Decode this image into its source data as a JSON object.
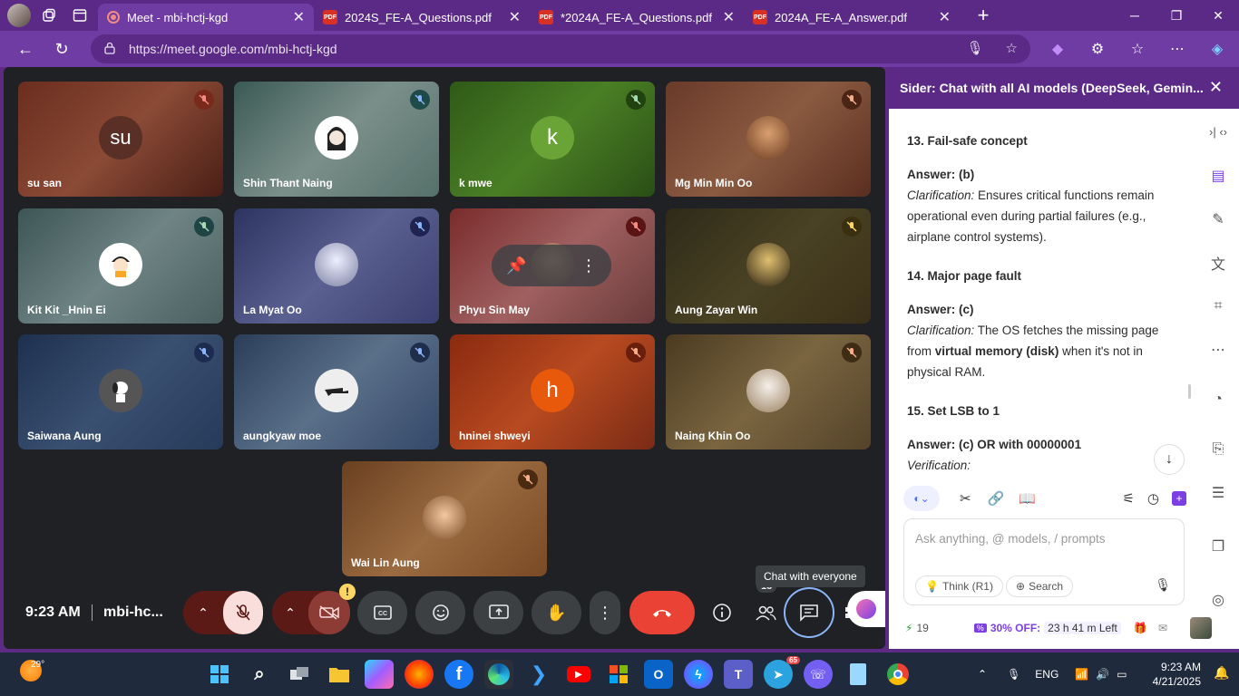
{
  "browser": {
    "tabs": [
      {
        "label": "Meet - mbi-hctj-kgd",
        "active": true
      },
      {
        "label": "2024S_FE-A_Questions.pdf",
        "active": false
      },
      {
        "label": "*2024A_FE-A_Questions.pdf",
        "active": false
      },
      {
        "label": "2024A_FE-A_Answer.pdf",
        "active": false
      }
    ],
    "url": "https://meet.google.com/mbi-hctj-kgd"
  },
  "meet": {
    "participants": [
      {
        "name": "su san",
        "initials": "su",
        "color": "#6b3a2a",
        "bg": "linear-gradient(135deg,#6b2d1f,#8a4a35,#4a1e16)"
      },
      {
        "name": "Shin Thant Naing",
        "initials": "",
        "color": "#fff",
        "bg": "linear-gradient(135deg,#3b5a55,#7b8f8a,#55706a)"
      },
      {
        "name": "k mwe",
        "initials": "k",
        "color": "#6aa336",
        "bg": "linear-gradient(135deg,#2f5a18,#4a7f25,#2a4e15)"
      },
      {
        "name": "Mg Min Min Oo",
        "initials": "",
        "color": "#a06a4a",
        "bg": "linear-gradient(135deg,#6a3a2a,#8a5a40,#5a2e20)"
      },
      {
        "name": "Kit Kit _Hnin Ei",
        "initials": "",
        "color": "#fff",
        "bg": "linear-gradient(135deg,#3d5555,#6f8484,#4a6060)"
      },
      {
        "name": "La Myat Oo",
        "initials": "",
        "color": "#556",
        "bg": "linear-gradient(135deg,#2e3460,#5a6090,#3a3f70)"
      },
      {
        "name": "Phyu Sin May",
        "initials": "",
        "color": "#a07060",
        "bg": "linear-gradient(135deg,#7a2c2c,#a06060,#6a3a3a)"
      },
      {
        "name": "Aung Zayar Win",
        "initials": "",
        "color": "#3a3020",
        "bg": "linear-gradient(135deg,#2e2a18,#4a4224,#3a3018)"
      },
      {
        "name": "Saiwana Aung",
        "initials": "",
        "color": "#555",
        "bg": "linear-gradient(135deg,#1e3050,#3a5070,#263a5a)"
      },
      {
        "name": "aungkyaw moe",
        "initials": "",
        "color": "#ddd",
        "bg": "linear-gradient(135deg,#2a3e5a,#5a6f88,#34486a)"
      },
      {
        "name": "hninei shweyi",
        "initials": "h",
        "color": "#e8590c",
        "bg": "linear-gradient(135deg,#8a2a10,#b84a20,#7a2a15)"
      },
      {
        "name": "Naing Khin Oo",
        "initials": "",
        "color": "#ccc",
        "bg": "linear-gradient(135deg,#4a3a20,#7a6540,#55432a)"
      },
      {
        "name": "Wai Lin Aung",
        "initials": "",
        "color": "#c08050",
        "bg": "linear-gradient(135deg,#6a4020,#9a6a40,#7a4a25)"
      }
    ],
    "time": "9:23 AM",
    "meeting_code": "mbi-hc...",
    "tooltip": "Chat with everyone",
    "people_count": "13",
    "badge": "!"
  },
  "sider": {
    "title": "Sider: Chat with all AI models (DeepSeek, Gemin...",
    "q13_title": "13. Fail-safe concept",
    "q13_answer": "Answer: (b)",
    "q13_clar_label": "Clarification:",
    "q13_clar_text": " Ensures critical functions remain operational even during partial failures (e.g., airplane control systems).",
    "q14_title": "14. Major page fault",
    "q14_answer": "Answer: (c)",
    "q14_clar_label": "Clarification:",
    "q14_clar_text1": " The OS fetches the missing page from ",
    "q14_clar_bold": "virtual memory (disk)",
    "q14_clar_text2": " when it's not in physical RAM.",
    "q15_title": "15. Set LSB to 1",
    "q15_answer": "Answer: (c) OR with 00000001",
    "q15_verif": "Verification:",
    "input_placeholder": "Ask anything, @ models, / prompts",
    "chip_think": "Think (R1)",
    "chip_search": "Search",
    "credits": "19",
    "promo": "30% OFF:",
    "promo_timer": "23 h 41 m Left"
  },
  "taskbar": {
    "weather": "29°",
    "lang": "ENG",
    "clock_time": "9:23 AM",
    "clock_date": "4/21/2025",
    "teams_badge": "65"
  },
  "colors": {
    "browser_frame": "#5b2a86",
    "end_call": "#ea4335",
    "muted_red": "#5c1a17",
    "sider_accent": "#7b3fe4"
  }
}
